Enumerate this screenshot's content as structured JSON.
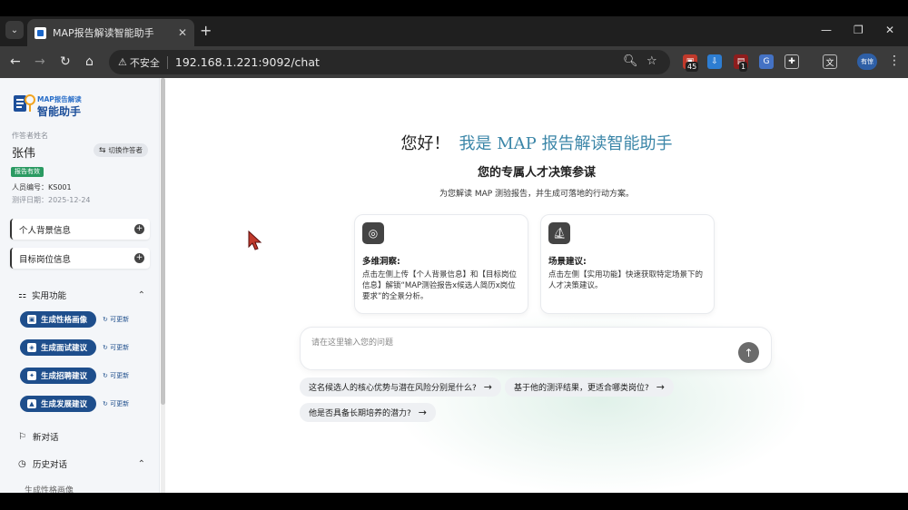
{
  "browser": {
    "tab_title": "MAP报告解读智能助手",
    "tab_close": "✕",
    "new_tab": "+",
    "security_label": "不安全",
    "url": "192.168.1.221:9092/chat",
    "ext_badge_1": "45",
    "ext_badge_2": "1",
    "profile_label": "有惊"
  },
  "sidebar": {
    "logo_small": "MAP报告解读",
    "logo_big": "智能助手",
    "author_label": "作答者姓名",
    "author_name": "张伟",
    "switch_label": "切换作答者",
    "status_badge": "报告有效",
    "id_label": "人员编号：",
    "id_value": "KS001",
    "date_label": "测评日期：",
    "date_value": "2025-12-24",
    "personal_info": "个人背景信息",
    "target_info": "目标岗位信息",
    "functions_title": "实用功能",
    "functions": [
      {
        "label": "生成性格画像",
        "refresh": "可更新"
      },
      {
        "label": "生成面试建议",
        "refresh": "可更新"
      },
      {
        "label": "生成招聘建议",
        "refresh": "可更新"
      },
      {
        "label": "生成发展建议",
        "refresh": "可更新"
      }
    ],
    "new_chat": "新对话",
    "history": "历史对话",
    "history_items": [
      "生成性格画像"
    ]
  },
  "main": {
    "greeting": "您好！",
    "brand": "我是 MAP 报告解读智能助手",
    "subtitle": "您的专属人才决策参谋",
    "description": "为您解读 MAP 测验报告，并生成可落地的行动方案。",
    "cards": [
      {
        "title": "多维洞察:",
        "desc": "点击左侧上传【个人背景信息】和【目标岗位信息】解锁“MAP测验报告x候选人简历x岗位要求”的全景分析。"
      },
      {
        "title": "场景建议:",
        "desc": "点击左侧【实用功能】快速获取特定场景下的人才决策建议。"
      }
    ],
    "input_placeholder": "请在这里输入您的问题",
    "suggestions": [
      "这名候选人的核心优势与潜在风险分别是什么?",
      "基于他的测评结果，更适合哪类岗位?",
      "他是否具备长期培养的潜力?"
    ]
  }
}
